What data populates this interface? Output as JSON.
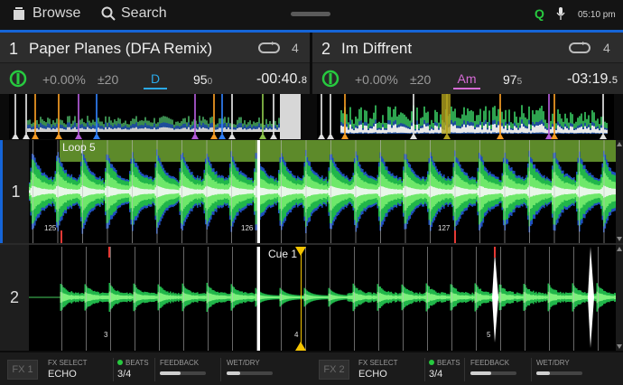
{
  "topbar": {
    "browse_label": "Browse",
    "search_label": "Search",
    "quantize_label": "Q",
    "time": "05:10 pm"
  },
  "decks": [
    {
      "number": "1",
      "title": "Paper Planes (DFA Remix)",
      "loop_count": "4",
      "pitch": "+0.00%",
      "range": "±20",
      "key": "D",
      "key_color": "#2aa9e8",
      "bpm_main": "95",
      "bpm_decimal": "0",
      "remaining_main": "-00:40.",
      "remaining_decimal": "8"
    },
    {
      "number": "2",
      "title": "Im Diffrent",
      "loop_count": "4",
      "pitch": "+0.00%",
      "range": "±20",
      "key": "Am",
      "key_color": "#d66bd6",
      "bpm_main": "97",
      "bpm_decimal": "5",
      "remaining_main": "-03:19.",
      "remaining_decimal": "5"
    }
  ],
  "lanes": {
    "lane1_label": "1",
    "lane2_label": "2",
    "loop_label": "Loop 5",
    "cue_label": "Cue 1",
    "beat_numbers_lane1": [
      "125",
      "126",
      "127"
    ],
    "beat_numbers_lane2": [
      "3",
      "4",
      "5"
    ]
  },
  "fx": [
    {
      "button": "FX 1",
      "select_label": "FX SELECT",
      "select_value": "ECHO",
      "beats_label": "BEATS",
      "beats_value": "3/4",
      "feedback_label": "FEEDBACK",
      "feedback_level": 0.45,
      "wetdry_label": "WET/DRY",
      "wetdry_level": 0.3
    },
    {
      "button": "FX 2",
      "select_label": "FX SELECT",
      "select_value": "ECHO",
      "beats_label": "BEATS",
      "beats_value": "3/4",
      "feedback_label": "FEEDBACK",
      "feedback_level": 0.45,
      "wetdry_label": "WET/DRY",
      "wetdry_level": 0.3
    }
  ],
  "colors": {
    "accent_blue": "#1565d8",
    "waveform_green": "#22c55e",
    "loop_bar": "#5d8a2a",
    "cue_yellow": "#f5c400"
  }
}
